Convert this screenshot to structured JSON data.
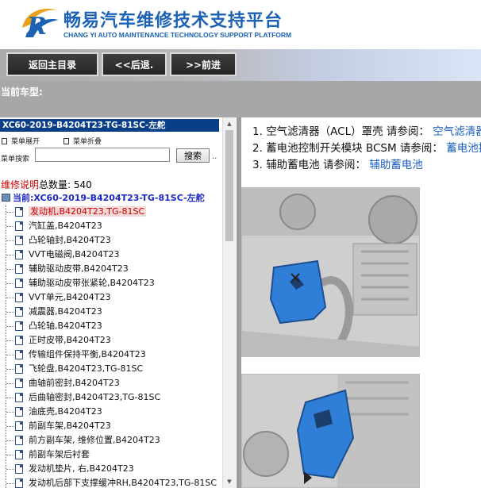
{
  "header": {
    "title_cn": "畅易汽车维修技术支持平台",
    "title_en": "CHANG YI AUTO MAINTENANCE TECHNOLOGY SUPPORT PLATFORM"
  },
  "nav": {
    "home": "返回主目录",
    "back": "<<后退.",
    "forward": ">>前进"
  },
  "car": {
    "label": "当前车型:"
  },
  "sidebar": {
    "model": "XC60-2019-B4204T23-TG-81SC-左舵",
    "menu_expand": "菜单展开",
    "menu_collapse": "菜单折叠",
    "search_label": "菜单搜索",
    "search_value": "",
    "search_button": "搜索",
    "search_more": "..",
    "count_link": "维修说明",
    "count_label": "总数量:",
    "count_value": "540",
    "current_node": "当前:XC60-2019-B4204T23-TG-81SC-左舵",
    "items": [
      {
        "label": "发动机,B4204T23,TG-81SC",
        "active": true
      },
      {
        "label": "汽缸盖,B4204T23"
      },
      {
        "label": "凸轮轴封,B4204T23"
      },
      {
        "label": "VVT电磁阀,B4204T23"
      },
      {
        "label": "辅助驱动皮带,B4204T23"
      },
      {
        "label": "辅助驱动皮带张紧轮,B4204T23"
      },
      {
        "label": "VVT单元,B4204T23"
      },
      {
        "label": "减震器,B4204T23"
      },
      {
        "label": "凸轮轴,B4204T23"
      },
      {
        "label": "正时皮带,B4204T23"
      },
      {
        "label": "传输组件保持平衡,B4204T23"
      },
      {
        "label": "飞轮盘,B4204T23,TG-81SC"
      },
      {
        "label": "曲轴前密封,B4204T23"
      },
      {
        "label": "后曲轴密封,B4204T23,TG-81SC"
      },
      {
        "label": "油底壳,B4204T23"
      },
      {
        "label": "前副车架,B4204T23"
      },
      {
        "label": "前方副车架, 维修位置,B4204T23"
      },
      {
        "label": "前副车架后衬套"
      },
      {
        "label": "发动机垫片, 右,B4204T23"
      },
      {
        "label": "发动机后部下支撑缓冲RH,B4204T23,TG-81SC"
      }
    ]
  },
  "content": {
    "refs": [
      {
        "num": "1.",
        "text": "空气滤清器（ACL）罩壳 请参阅：",
        "link": "空气滤清器（ACL）罩壳"
      },
      {
        "num": "2.",
        "text": "蓄电池控制开关模块 BCSM 请参阅：",
        "link": "蓄电池控制开关模块 BCSM"
      },
      {
        "num": "3.",
        "text": "辅助蓄电池 请参阅：",
        "link": "辅助蓄电池"
      }
    ]
  },
  "colors": {
    "brand_blue": "#1b62b4",
    "model_bar": "#0a3f88",
    "link_blue": "#1a5fc2",
    "active_red": "#cc0000",
    "highlight_part": "#2f7fd8"
  }
}
